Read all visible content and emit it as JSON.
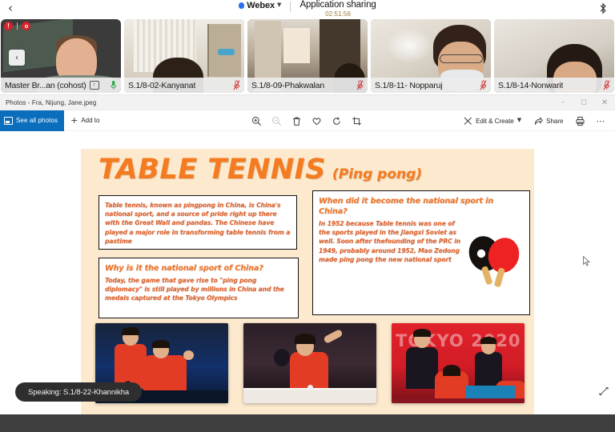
{
  "webex": {
    "back_icon": "chevron-left-icon",
    "brand": "Webex",
    "brand_dropdown_icon": "chevron-down-icon",
    "session_title": "Application sharing",
    "timer": "02:51:56",
    "bluetooth_icon": "bluetooth-icon",
    "speaking_status": "Speaking: S.1/8-22-Khannikha",
    "self_tile_badges": {
      "alert_count": "!",
      "recording_icon": "record-icon"
    },
    "participants": [
      {
        "name": "Master Br...an (cohost)",
        "mic": "mic-on",
        "present_icon": "present-icon",
        "scene": "sc1"
      },
      {
        "name": "S.1/8-02-Kanyanat",
        "mic": "mic-muted",
        "scene": "sc2"
      },
      {
        "name": "S.1/8-09-Phakwalan",
        "mic": "mic-muted",
        "scene": "sc3"
      },
      {
        "name": "S.1/8-11- Nopparuj",
        "mic": "mic-muted",
        "scene": "sc4"
      },
      {
        "name": "S.1/8-14-Nonwarit",
        "mic": "mic-muted",
        "scene": "sc5"
      }
    ]
  },
  "photos_app": {
    "window_title": "Photos - Fra, Nijung, Jane.jpeg",
    "window_controls": {
      "minimize": "minimize-icon",
      "maximize": "maximize-icon",
      "close": "close-icon"
    },
    "toolbar": {
      "see_all_photos": "See all photos",
      "add_to": "Add to",
      "edit_create": "Edit & Create",
      "share": "Share",
      "print_icon": "print-icon",
      "more_icon": "more-options-icon",
      "center_icons": [
        {
          "name": "zoom-in-icon",
          "state": "enabled"
        },
        {
          "name": "zoom-out-icon",
          "state": "disabled"
        },
        {
          "name": "delete-icon",
          "state": "enabled"
        },
        {
          "name": "favorite-icon",
          "state": "enabled"
        },
        {
          "name": "rotate-icon",
          "state": "enabled"
        },
        {
          "name": "crop-icon",
          "state": "enabled"
        }
      ]
    },
    "resize_handle_icon": "resize-handle-icon",
    "cursor_icon": "cursor-arrow-icon"
  },
  "poster": {
    "title_main": "TABLE TENNIS",
    "title_sub": "(Ping pong)",
    "box_a": {
      "body": "Table tennis, known as pingpong in China, is China's national sport, and a source of pride right up there with the Great Wall and pandas. The Chinese have played a major role in transforming table tennis from a pastime"
    },
    "box_b": {
      "head": "Why is it the national sport of China?",
      "body": "Today, the game that gave rise to \"ping pong diplomacy\" is still played by millions in China and the medals captured at the Tokyo Olympics"
    },
    "box_c": {
      "head": "When did it become the national sport in China?",
      "body": "In 1952 because Table tennis was one of the sports played in the Jiangxi Soviet as well. Soon after thefounding of the PRC in 1949, probably around 1952, Mao Zedong made ping pong the new national sport",
      "illustration": "ping-pong-paddles-icon"
    },
    "photos": [
      {
        "caption_overlay": "",
        "alt": "two-chinese-players-doubles"
      },
      {
        "caption_overlay": "",
        "alt": "female-player-serving"
      },
      {
        "caption_overlay": "TOKYO 2020",
        "alt": "tokyo-2020-mixed-doubles"
      }
    ],
    "colors": {
      "background": "#fdeace",
      "accent": "#F47B20",
      "body_text": "#E2622C"
    }
  }
}
